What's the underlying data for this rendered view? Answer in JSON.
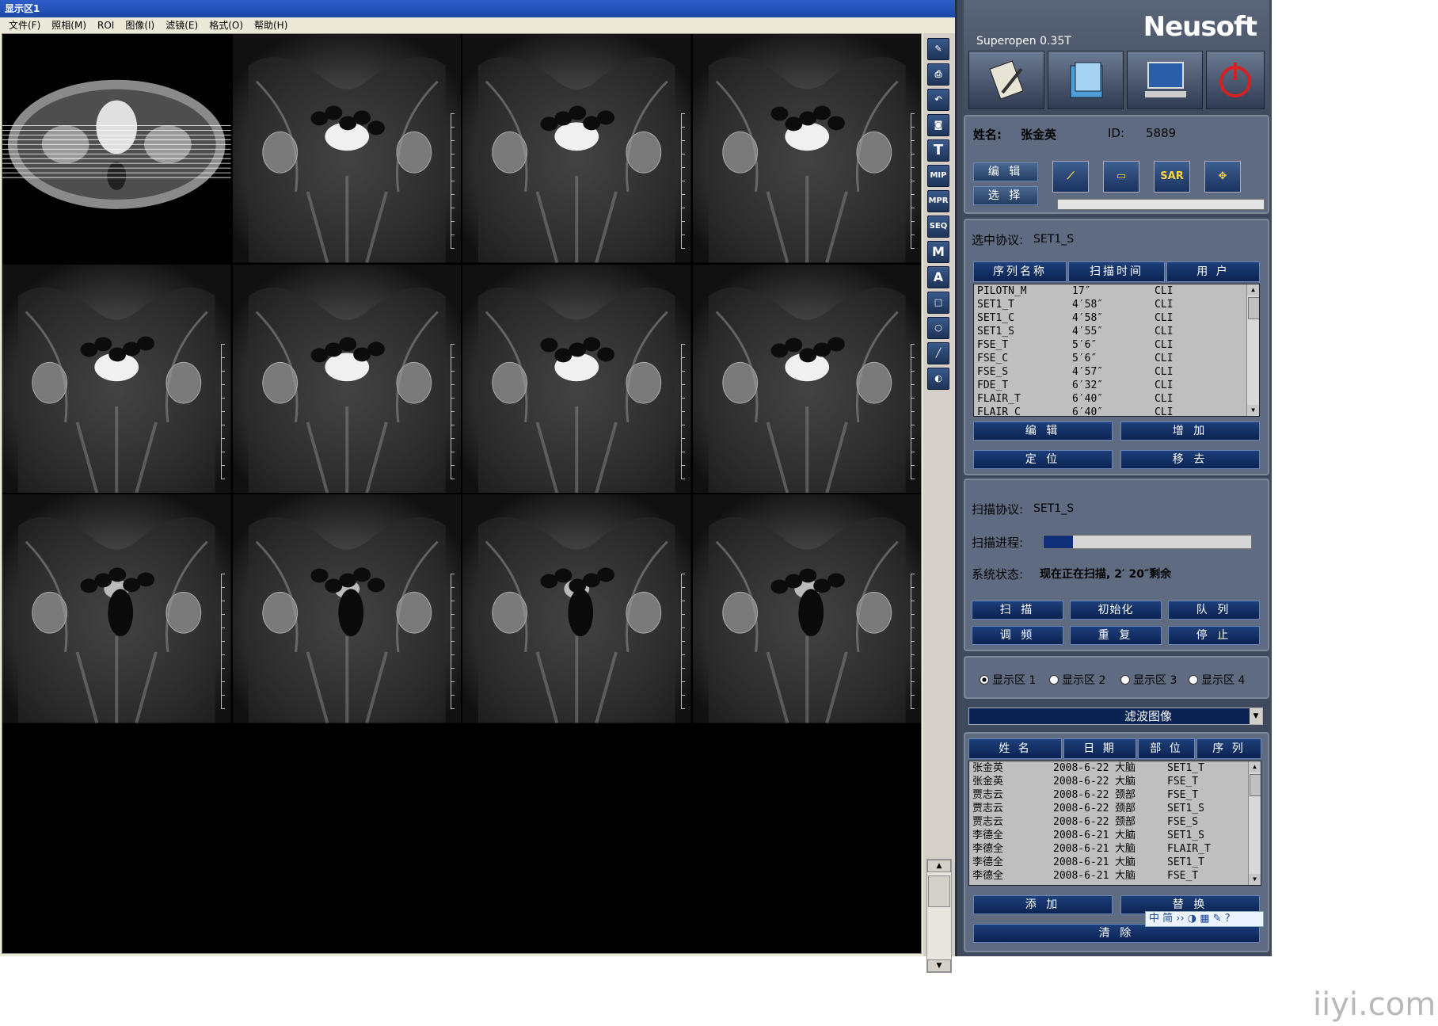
{
  "window": {
    "title": "显示区1"
  },
  "menu": [
    "文件(F)",
    "照相(M)",
    "ROI",
    "图像(I)",
    "滤镜(E)",
    "格式(O)",
    "帮助(H)"
  ],
  "viewer": {
    "selected_cell": 5,
    "filled_cells": 12,
    "total_cells": 16
  },
  "toolbar_icons": [
    "eraser-icon",
    "print-icon",
    "undo-icon",
    "camera-icon",
    "text-T-icon",
    "MIP",
    "MPR",
    "SEQ",
    "M",
    "A",
    "rectangle-icon",
    "circle-icon",
    "line-icon",
    "contrast-icon"
  ],
  "toolbar_text": {
    "t": "T",
    "mip": "MIP",
    "mpr": "MPR",
    "seq": "SEQ",
    "m": "M",
    "a": "A"
  },
  "brand": {
    "logo": "Neusoft",
    "model": "Superopen 0.35T"
  },
  "patient": {
    "name_label": "姓名:",
    "name": "张金英",
    "id_label": "ID:",
    "id": "5889"
  },
  "actions": {
    "edit": "编 辑",
    "select": "选 择",
    "sar": "SAR"
  },
  "protocol": {
    "selected_label": "选中协议:",
    "selected_value": "SET1_S",
    "headers": [
      "序列名称",
      "扫描时间",
      "用 户"
    ],
    "rows": [
      [
        "PILOTN_M",
        "17″",
        "CLI"
      ],
      [
        "SET1_T",
        "4′58″",
        "CLI"
      ],
      [
        "SET1_C",
        "4′58″",
        "CLI"
      ],
      [
        "SET1_S",
        "4′55″",
        "CLI"
      ],
      [
        "FSE_T",
        "5′6″",
        "CLI"
      ],
      [
        "FSE_C",
        "5′6″",
        "CLI"
      ],
      [
        "FSE_S",
        "4′57″",
        "CLI"
      ],
      [
        "FDE_T",
        "6′32″",
        "CLI"
      ],
      [
        "FLAIR_T",
        "6′40″",
        "CLI"
      ],
      [
        "FLAIR_C",
        "6′40″",
        "CLI"
      ]
    ],
    "buttons": [
      "编 辑",
      "增 加",
      "定 位",
      "移 去"
    ]
  },
  "scan": {
    "protocol_label": "扫描协议:",
    "protocol_value": "SET1_S",
    "progress_label": "扫描进程:",
    "progress": 0.14,
    "status_label": "系统状态:",
    "status_value": "现在正在扫描, 2′ 20″剩余",
    "buttons": [
      "扫 描",
      "初始化",
      "队 列",
      "调 频",
      "重 复",
      "停 止"
    ]
  },
  "display_areas": {
    "options": [
      "显示区 1",
      "显示区 2",
      "显示区 3",
      "显示区 4"
    ],
    "selected": 0
  },
  "filter_combo": "滤波图像",
  "studies": {
    "headers": [
      "姓 名",
      "日 期",
      "部 位",
      "序 列"
    ],
    "rows": [
      [
        "张金英",
        "2008-6-22",
        "大脑",
        "SET1_T"
      ],
      [
        "张金英",
        "2008-6-22",
        "大脑",
        "FSE_T"
      ],
      [
        "贾志云",
        "2008-6-22",
        "颈部",
        "FSE_T"
      ],
      [
        "贾志云",
        "2008-6-22",
        "颈部",
        "SET1_S"
      ],
      [
        "贾志云",
        "2008-6-22",
        "颈部",
        "FSE_S"
      ],
      [
        "李德全",
        "2008-6-21",
        "大脑",
        "SET1_S"
      ],
      [
        "李德全",
        "2008-6-21",
        "大脑",
        "FLAIR_T"
      ],
      [
        "李德全",
        "2008-6-21",
        "大脑",
        "SET1_T"
      ],
      [
        "李德全",
        "2008-6-21",
        "大脑",
        "FSE_T"
      ]
    ],
    "buttons": [
      "添 加",
      "替 换",
      "清 除"
    ]
  },
  "ime_bar": "中 简 ›› ◑ ▦ ✎ ?",
  "watermark": "iiyi.com"
}
